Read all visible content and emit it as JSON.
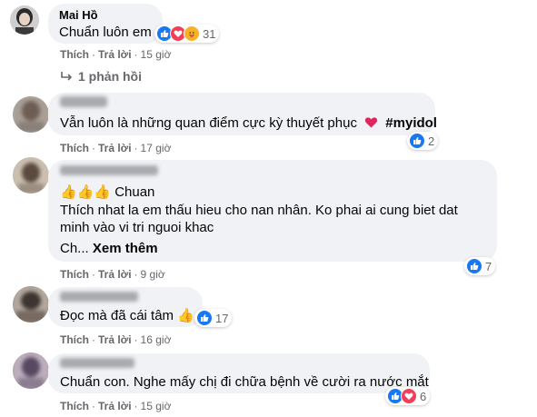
{
  "comments": [
    {
      "author": "Mai Hồ",
      "text": "Chuẩn luôn em",
      "reaction_count": "31",
      "like_label": "Thích",
      "reply_label": "Trả lời",
      "time": "15 giờ",
      "replies_label": "1 phản hồi"
    },
    {
      "author": "",
      "text": "Vẫn luôn là những quan điểm cực kỳ thuyết phục",
      "hashtag": "#myidol",
      "reaction_count": "2",
      "like_label": "Thích",
      "reply_label": "Trả lời",
      "time": "17 giờ"
    },
    {
      "author": "",
      "text_line1": "👍👍👍 Chuan",
      "text_line2": "Thích nhat la em thấu hieu cho nan nhân. Ko phai ai cung biet dat",
      "text_line3": "minh vào vi tri nguoi khac",
      "text_line4": "Ch...",
      "see_more": "Xem thêm",
      "reaction_count": "7",
      "like_label": "Thích",
      "reply_label": "Trả lời",
      "time": "9 giờ"
    },
    {
      "author": "",
      "text": "Đọc mà đã cái tâm 👍",
      "reaction_count": "17",
      "like_label": "Thích",
      "reply_label": "Trả lời",
      "time": "16 giờ"
    },
    {
      "author": "",
      "text": "Chuẩn con. Nghe mấy chị đi chữa bệnh về cười ra nước mắt",
      "reaction_count": "6",
      "like_label": "Thích",
      "reply_label": "Trả lời",
      "time": "15 giờ"
    }
  ],
  "colors": {
    "bubble": "#f0f2f5",
    "like": "#1877f2",
    "love": "#f33e58",
    "care": "#f7b125",
    "muted": "#65676b"
  }
}
